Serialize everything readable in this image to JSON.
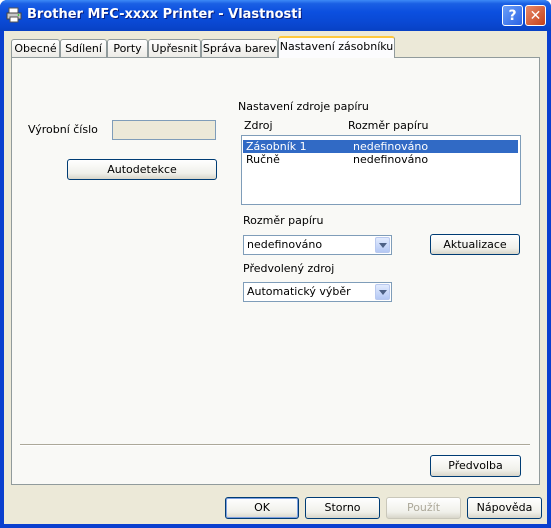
{
  "window": {
    "title": "Brother MFC-xxxx Printer - Vlastnosti",
    "help_label": "?",
    "close_label": "✕"
  },
  "tabs": [
    {
      "label": "Obecné"
    },
    {
      "label": "Sdílení"
    },
    {
      "label": "Porty"
    },
    {
      "label": "Upřesnit"
    },
    {
      "label": "Správa barev"
    },
    {
      "label": "Nastavení zásobníku"
    }
  ],
  "active_tab": "Nastavení zásobníku",
  "serial": {
    "label": "Výrobní číslo",
    "value": ""
  },
  "autodetect_label": "Autodetekce",
  "source_settings": {
    "heading": "Nastavení zdroje papíru",
    "col_source": "Zdroj",
    "col_size": "Rozměr papíru",
    "rows": [
      {
        "source": "Zásobník 1",
        "size": "nedefinováno",
        "selected": true
      },
      {
        "source": "Ručně",
        "size": "nedefinováno",
        "selected": false
      }
    ]
  },
  "paper_size": {
    "label": "Rozměr papíru",
    "value": "nedefinováno"
  },
  "update_label": "Aktualizace",
  "default_source": {
    "label": "Předvolený zdroj",
    "value": "Automatický výběr"
  },
  "defaults_label": "Předvolba",
  "footer": {
    "ok": "OK",
    "cancel": "Storno",
    "apply": "Použít",
    "help": "Nápověda"
  }
}
